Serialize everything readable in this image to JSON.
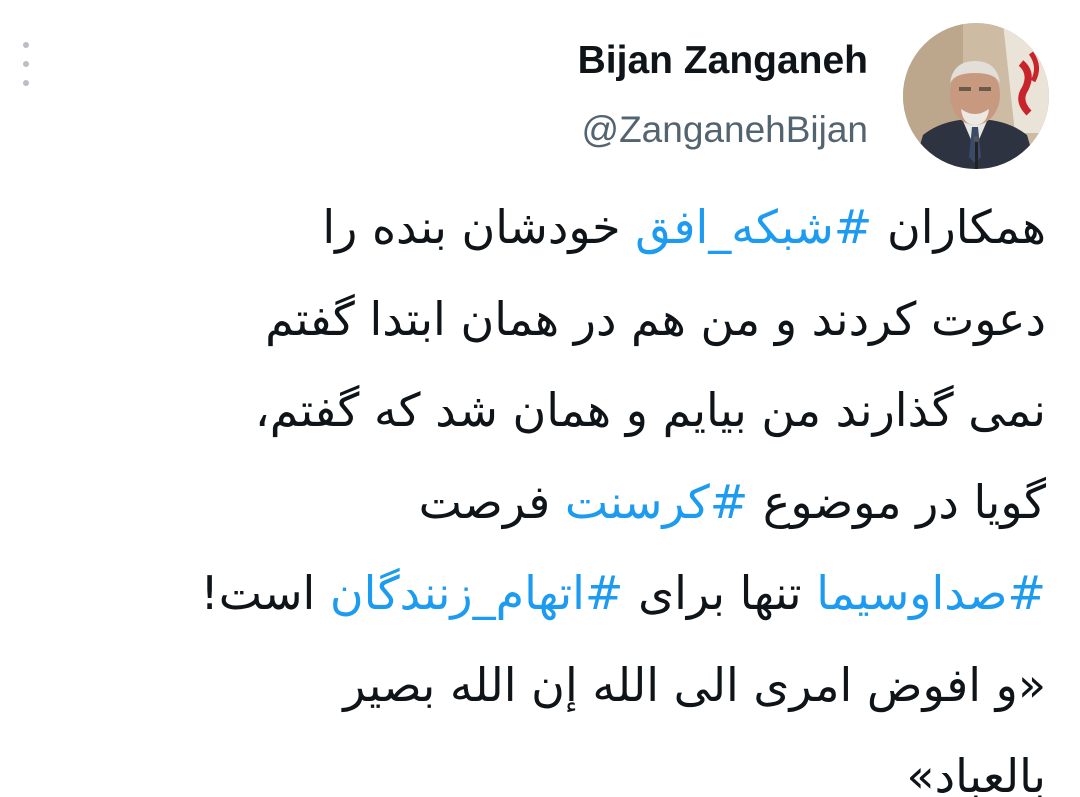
{
  "tweet": {
    "author": {
      "display_name": "Bijan Zanganeh",
      "handle": "@ZanganehBijan",
      "avatar_icon": "profile-photo"
    },
    "more_icon": "three-dots-vertical-icon",
    "colors": {
      "text": "#0f1419",
      "secondary": "#536471",
      "hashtag": "#1d9bf0"
    },
    "lines": [
      {
        "t1": "همکاران ",
        "h1": "#شبکه_افق",
        "t2": " خودشان بنده را"
      },
      {
        "t1": "دعوت کردند و من هم در همان ابتدا گفتم"
      },
      {
        "t1": "نمی گذارند من بیایم و همان شد که گفتم،"
      },
      {
        "t1": "گویا در موضوع ",
        "h1": "#کرسنت",
        "t2": " فرصت"
      },
      {
        "h1": "#صداوسیما",
        "t2": " تنها برای ",
        "h2": "#اتهام_زنندگان",
        "t3": " است!"
      },
      {
        "t1": "«و افوض امری الی الله إن الله بصیر"
      },
      {
        "t1": "بالعباد»"
      }
    ]
  }
}
